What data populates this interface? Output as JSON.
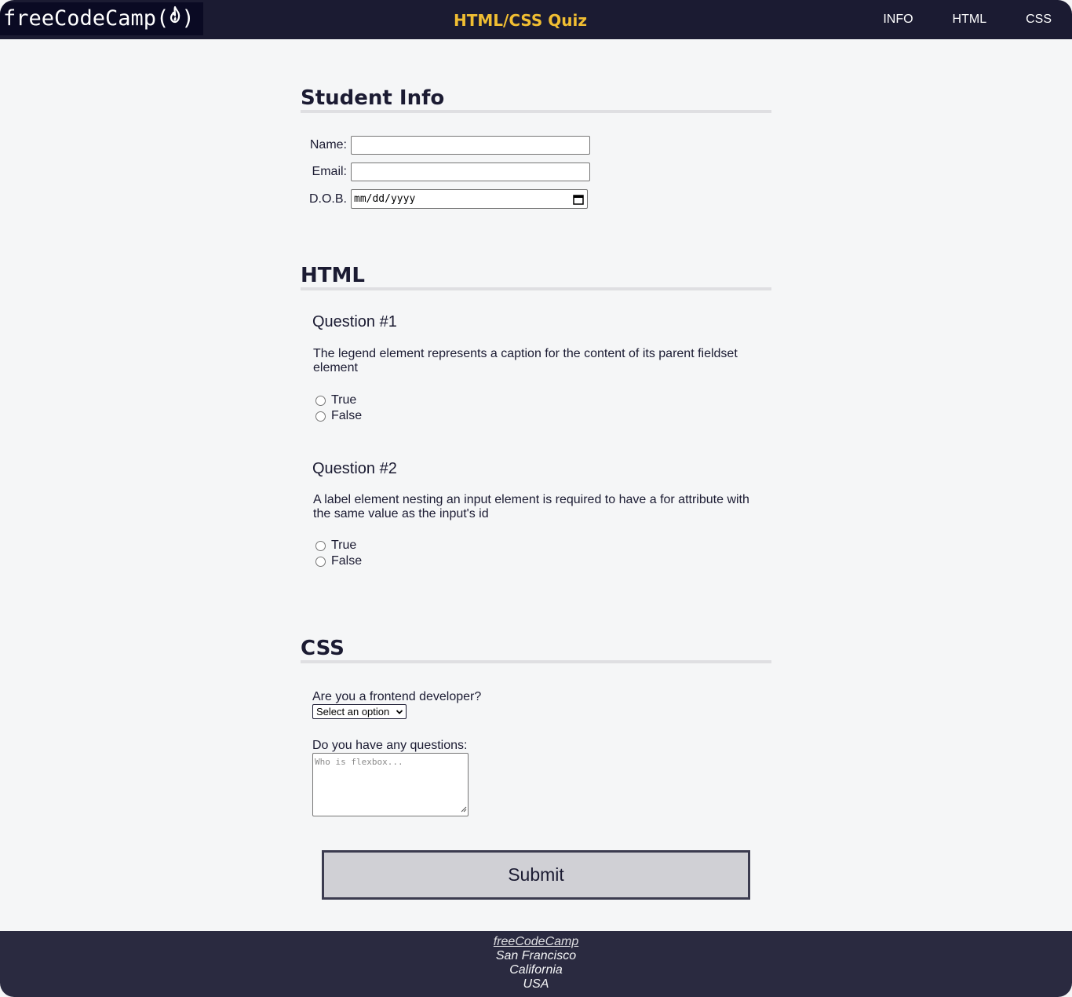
{
  "header": {
    "logo_text": "freeCodeCamp(",
    "logo_close": ")",
    "title": "HTML/CSS Quiz",
    "nav": [
      "INFO",
      "HTML",
      "CSS"
    ]
  },
  "student_info": {
    "title": "Student Info",
    "name_label": "Name:",
    "email_label": "Email:",
    "dob_label": "D.O.B.",
    "dob_placeholder": "mm/dd/yyyy",
    "name_value": "",
    "email_value": ""
  },
  "html_section": {
    "title": "HTML",
    "questions": [
      {
        "title": "Question #1",
        "text": "The legend element represents a caption for the content of its parent fieldset element",
        "options": [
          "True",
          "False"
        ]
      },
      {
        "title": "Question #2",
        "text": "A label element nesting an input element is required to have a for attribute with the same value as the input's id",
        "options": [
          "True",
          "False"
        ]
      }
    ]
  },
  "css_section": {
    "title": "CSS",
    "frontend_label": "Are you a frontend developer?",
    "select_value": "Select an option",
    "questions_label": "Do you have any questions:",
    "textarea_placeholder": "Who is flexbox..."
  },
  "submit_label": "Submit",
  "footer": {
    "link": "freeCodeCamp",
    "city": "San Francisco",
    "state": "California",
    "country": "USA"
  },
  "colors": {
    "header_bg": "#1b1b32",
    "title_accent": "#f1be32",
    "page_bg": "#f5f6f7",
    "footer_bg": "#2a2a40"
  }
}
